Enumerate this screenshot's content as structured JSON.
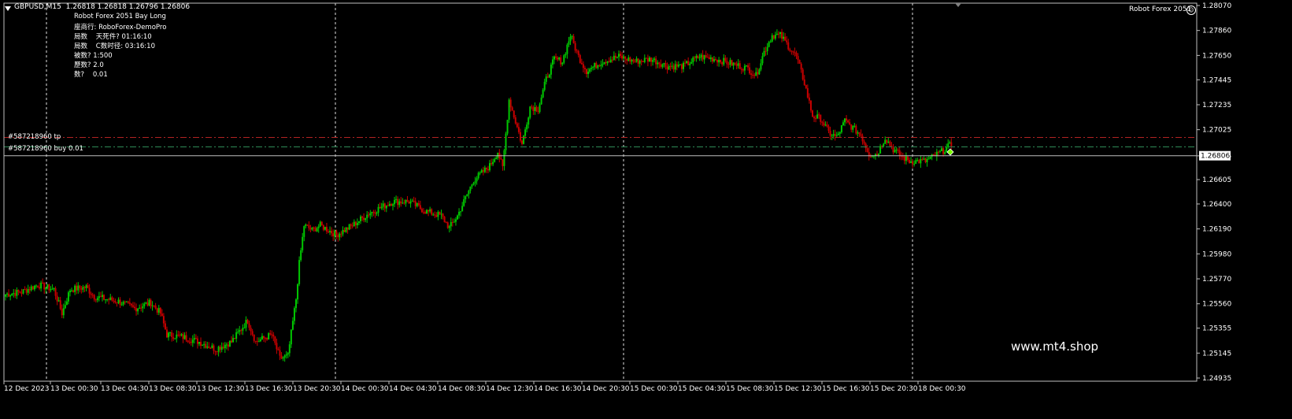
{
  "header": {
    "symbol_line": "GBPUSD,M15  1.26818 1.26818 1.26796 1.26806",
    "ea_name": "Robot Forex 2051 Bay Long",
    "info_lines": [
      "座商行: RoboForex-DemoPro",
      "局数    天死件? 01:16:10",
      "局数    C数时径: 03:16:10",
      "被数? 1:500",
      "歷数? 2.0",
      "数?    0.01"
    ],
    "ea_badge": "Robot Forex 2051",
    "watermark": "www.mt4.shop"
  },
  "order_lines": [
    {
      "label": "#587218960 tp",
      "price": 1.2696,
      "color": "#b22222",
      "style": "dashdot"
    },
    {
      "label": "#587218960 buy 0.01",
      "price": 1.2688,
      "color": "#2e8b57",
      "style": "dashdot"
    }
  ],
  "bid_line": {
    "price": 1.26806,
    "label": "1.26806",
    "color": "#c0c0c0"
  },
  "chart_data": {
    "type": "candlestick",
    "symbol": "GBPUSD",
    "timeframe": "M15",
    "ylim": [
      1.24935,
      1.2807
    ],
    "y_ticks": [
      "1.28070",
      "1.27860",
      "1.27650",
      "1.27445",
      "1.27235",
      "1.27025",
      "1.26805",
      "1.26605",
      "1.26400",
      "1.26190",
      "1.25980",
      "1.25770",
      "1.25560",
      "1.25355",
      "1.25145",
      "1.24935"
    ],
    "x_ticks": [
      "12 Dec 2023",
      "13 Dec 00:30",
      "13 Dec 04:30",
      "13 Dec 08:30",
      "13 Dec 12:30",
      "13 Dec 16:30",
      "13 Dec 20:30",
      "14 Dec 00:30",
      "14 Dec 04:30",
      "14 Dec 08:30",
      "14 Dec 12:30",
      "14 Dec 16:30",
      "14 Dec 20:30",
      "15 Dec 00:30",
      "15 Dec 04:30",
      "15 Dec 08:30",
      "15 Dec 12:30",
      "15 Dec 16:30",
      "15 Dec 20:30",
      "18 Dec 00:30"
    ],
    "separators": [
      "13 Dec 00:00",
      "14 Dec 00:00",
      "15 Dec 00:00",
      "18 Dec 00:00"
    ],
    "up_color": "#00c800",
    "down_color": "#c80000",
    "close_path": [
      [
        0,
        1.2564
      ],
      [
        10,
        1.2566
      ],
      [
        20,
        1.2572
      ],
      [
        30,
        1.2568
      ],
      [
        35,
        1.2548
      ],
      [
        40,
        1.2568
      ],
      [
        50,
        1.257
      ],
      [
        55,
        1.2562
      ],
      [
        70,
        1.2558
      ],
      [
        80,
        1.2552
      ],
      [
        90,
        1.2557
      ],
      [
        96,
        1.2548
      ],
      [
        100,
        1.253
      ],
      [
        110,
        1.2528
      ],
      [
        120,
        1.2524
      ],
      [
        130,
        1.2518
      ],
      [
        140,
        1.2524
      ],
      [
        150,
        1.2542
      ],
      [
        155,
        1.2524
      ],
      [
        165,
        1.253
      ],
      [
        170,
        1.251
      ],
      [
        175,
        1.2512
      ],
      [
        180,
        1.256
      ],
      [
        182,
        1.259
      ],
      [
        185,
        1.2622
      ],
      [
        190,
        1.2618
      ],
      [
        195,
        1.2622
      ],
      [
        205,
        1.2614
      ],
      [
        215,
        1.2622
      ],
      [
        225,
        1.2632
      ],
      [
        240,
        1.2642
      ],
      [
        250,
        1.2642
      ],
      [
        260,
        1.2634
      ],
      [
        270,
        1.263
      ],
      [
        275,
        1.262
      ],
      [
        280,
        1.263
      ],
      [
        290,
        1.266
      ],
      [
        300,
        1.2672
      ],
      [
        305,
        1.2684
      ],
      [
        308,
        1.267
      ],
      [
        312,
        1.2728
      ],
      [
        318,
        1.27
      ],
      [
        320,
        1.269
      ],
      [
        325,
        1.2722
      ],
      [
        330,
        1.272
      ],
      [
        335,
        1.2745
      ],
      [
        340,
        1.2762
      ],
      [
        345,
        1.276
      ],
      [
        350,
        1.2782
      ],
      [
        355,
        1.2764
      ],
      [
        360,
        1.2752
      ],
      [
        370,
        1.276
      ],
      [
        380,
        1.2764
      ],
      [
        390,
        1.276
      ],
      [
        400,
        1.2762
      ],
      [
        410,
        1.2756
      ],
      [
        420,
        1.2756
      ],
      [
        430,
        1.2764
      ],
      [
        440,
        1.2762
      ],
      [
        450,
        1.2758
      ],
      [
        460,
        1.2754
      ],
      [
        465,
        1.2748
      ],
      [
        470,
        1.2768
      ],
      [
        475,
        1.2782
      ],
      [
        480,
        1.2782
      ],
      [
        490,
        1.2764
      ],
      [
        495,
        1.2742
      ],
      [
        500,
        1.2714
      ],
      [
        505,
        1.2712
      ],
      [
        510,
        1.27
      ],
      [
        515,
        1.2696
      ],
      [
        520,
        1.271
      ],
      [
        525,
        1.2704
      ],
      [
        530,
        1.2698
      ],
      [
        535,
        1.2682
      ],
      [
        540,
        1.2682
      ],
      [
        545,
        1.2696
      ],
      [
        550,
        1.2686
      ],
      [
        555,
        1.268
      ],
      [
        560,
        1.2676
      ],
      [
        565,
        1.2676
      ],
      [
        570,
        1.2676
      ],
      [
        580,
        1.2684
      ],
      [
        586,
        1.269
      ]
    ]
  }
}
